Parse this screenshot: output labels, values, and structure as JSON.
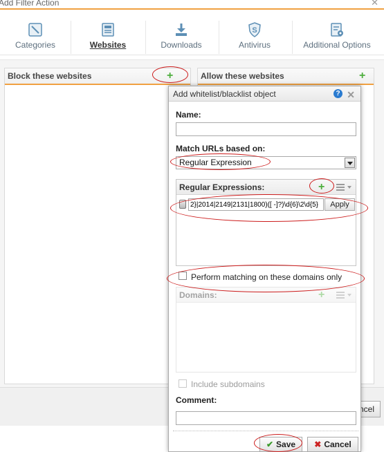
{
  "window": {
    "title": "Add Filter Action",
    "close_glyph": "✕"
  },
  "tabs": [
    {
      "label": "Categories",
      "icon": "categories-icon"
    },
    {
      "label": "Websites",
      "icon": "websites-icon",
      "active": true
    },
    {
      "label": "Downloads",
      "icon": "download-icon"
    },
    {
      "label": "Antivirus",
      "icon": "antivirus-icon"
    },
    {
      "label": "Additional Options",
      "icon": "options-icon"
    }
  ],
  "block_panel": {
    "title": "Block these websites"
  },
  "allow_panel": {
    "title": "Allow these websites"
  },
  "background_cancel": {
    "label": "ncel"
  },
  "dialog": {
    "title": "Add whitelist/blacklist object",
    "help_glyph": "?",
    "name": {
      "label": "Name:",
      "value": ""
    },
    "match": {
      "label": "Match URLs based on:",
      "selected": "Regular Expression"
    },
    "regex": {
      "label": "Regular Expressions:",
      "entry_value": "2}|2014|2149|2131|1800)([ -]?)\\d{6}\\2\\d{5}",
      "apply_label": "Apply"
    },
    "perform_matching": {
      "label": "Perform matching on these domains only",
      "checked": false
    },
    "domains": {
      "label": "Domains:"
    },
    "include_subdomains": {
      "label": "Include subdomains",
      "checked": false
    },
    "comment": {
      "label": "Comment:",
      "value": ""
    },
    "save_label": "Save",
    "cancel_label": "Cancel"
  },
  "colors": {
    "accent": "#f0a040",
    "plus": "#4cae3c",
    "annotation": "#cc1b1b",
    "help": "#2a7bd0"
  }
}
